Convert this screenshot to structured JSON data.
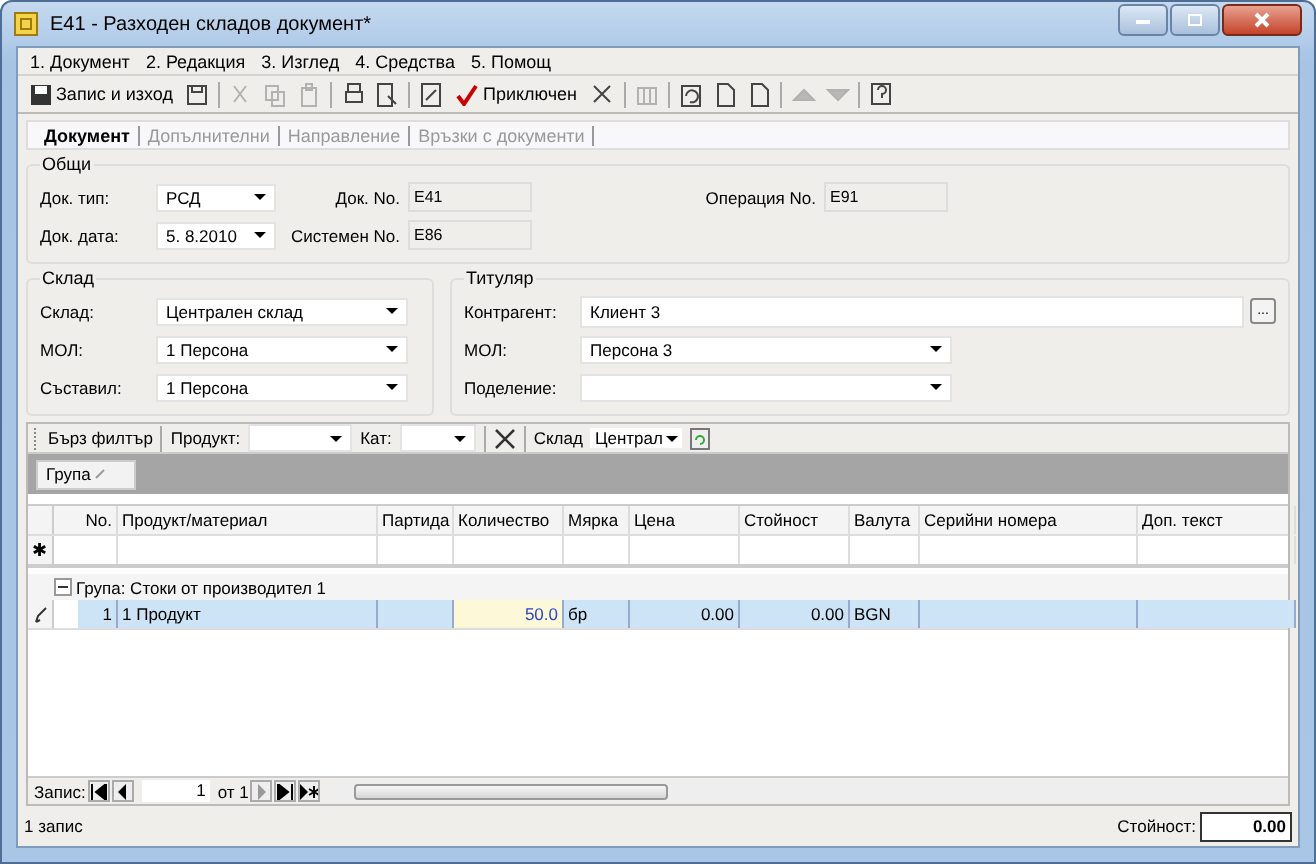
{
  "window": {
    "title": "E41 - Разходен складов документ*"
  },
  "menu": [
    "1. Документ",
    "2. Редакция",
    "3. Изглед",
    "4. Средства",
    "5. Помощ"
  ],
  "toolbar": [
    {
      "kind": "save",
      "label": "Запис и изход",
      "disabled": false
    },
    {
      "kind": "save-as",
      "disabled": false
    },
    {
      "kind": "cut",
      "disabled": true
    },
    {
      "kind": "copy",
      "disabled": true
    },
    {
      "kind": "paste",
      "disabled": true
    },
    {
      "kind": "print",
      "disabled": false
    },
    {
      "kind": "preview",
      "disabled": false
    },
    {
      "kind": "edit",
      "disabled": false
    },
    {
      "kind": "finish",
      "label": "Приключен",
      "disabled": false
    },
    {
      "kind": "delete",
      "disabled": false
    },
    {
      "kind": "columns",
      "disabled": true
    },
    {
      "kind": "refresh",
      "disabled": false
    },
    {
      "kind": "page",
      "disabled": false
    },
    {
      "kind": "page",
      "disabled": false
    },
    {
      "kind": "up",
      "disabled": true
    },
    {
      "kind": "down",
      "disabled": true
    },
    {
      "kind": "help",
      "disabled": false
    }
  ],
  "tabs": [
    {
      "label": "Документ",
      "selected": true
    },
    {
      "label": "Допълнителни",
      "selected": false
    },
    {
      "label": "Направление",
      "selected": false
    },
    {
      "label": "Връзки с документи",
      "selected": false
    }
  ],
  "general": {
    "title": "Общи",
    "doc_type_label": "Док. тип:",
    "doc_type": "РСД",
    "doc_no_label": "Док. No.",
    "doc_no": "E41",
    "operation_no_label": "Операция No.",
    "operation_no": "E91",
    "doc_date_label": "Док. дата:",
    "doc_date": "5. 8.2010",
    "system_no_label": "Системен No.",
    "system_no": "E86"
  },
  "warehouse": {
    "title": "Склад",
    "fields": [
      {
        "label": "Склад:",
        "value": "Централен склад"
      },
      {
        "label": "МОЛ:",
        "value": "1 Персона"
      },
      {
        "label": "Съставил:",
        "value": "1 Персона"
      }
    ]
  },
  "holder": {
    "title": "Титуляр",
    "fields": [
      {
        "kind": "text",
        "label": "Контрагент:",
        "value": "Клиент 3",
        "button": "..."
      },
      {
        "kind": "dropdown",
        "label": "МОЛ:",
        "value": "Персона 3"
      },
      {
        "kind": "dropdown",
        "label": "Поделение:"
      }
    ]
  },
  "filter": {
    "title": "Бърз филтър",
    "product_label": "Продукт:",
    "category_label": "Кат:",
    "warehouse_label": "Склад",
    "warehouse": "Централ"
  },
  "grouping": {
    "chip": "Група"
  },
  "table": {
    "columns": [
      "No.",
      "Продукт/материал",
      "Партида",
      "Количество",
      "Мярка",
      "Цена",
      "Стойност",
      "Валута",
      "Серийни номера",
      "Доп. текст"
    ],
    "new_row_marker": "✱",
    "groups": [
      {
        "label": "Група: Стоки от производител 1",
        "expanded": true,
        "rows": [
          {
            "selected": true,
            "cells": [
              "1",
              "1 Продукт",
              "",
              "50.0",
              "бр",
              "0.00",
              "0.00",
              "BGN",
              "",
              ""
            ]
          }
        ]
      }
    ]
  },
  "navigator": {
    "label": "Запис:",
    "current": "1",
    "of": "от 1"
  },
  "status_bar": {
    "count": "1 запис",
    "total_label": "Стойност:",
    "total": "0.00"
  }
}
